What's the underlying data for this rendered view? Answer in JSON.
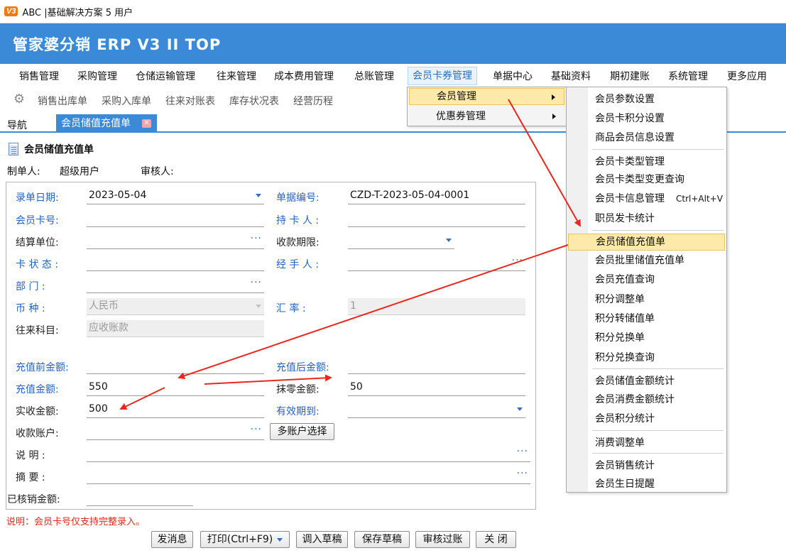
{
  "titlebar": {
    "logo": "V3",
    "title": "ABC  |基础解决方案 5 用户"
  },
  "banner": {
    "app_name": "管家婆分销 ERP V3 II TOP"
  },
  "menu": [
    {
      "label": "销售管理"
    },
    {
      "label": "采购管理"
    },
    {
      "label": "仓储运输管理"
    },
    {
      "label": "往来管理"
    },
    {
      "label": "成本费用管理"
    },
    {
      "label": "总账管理"
    },
    {
      "label": "会员卡券管理"
    },
    {
      "label": "单据中心"
    },
    {
      "label": "基础资料"
    },
    {
      "label": "期初建账"
    },
    {
      "label": "系统管理"
    },
    {
      "label": "更多应用"
    }
  ],
  "toolbar": [
    "销售出库单",
    "采购入库单",
    "往来对账表",
    "库存状况表",
    "经营历程"
  ],
  "tabs": {
    "nav": "导航",
    "active": "会员储值充值单",
    "close": "✕"
  },
  "form": {
    "title": "会员储值充值单",
    "maker_label": "制单人:",
    "maker_value": "超级用户",
    "auditor_label": "审核人:",
    "fields": {
      "entry_date": {
        "label": "录单日期:",
        "value": "2023-05-04"
      },
      "doc_no": {
        "label": "单据编号:",
        "value": "CZD-T-2023-05-04-0001"
      },
      "card_no": {
        "label": "会员卡号:",
        "value": ""
      },
      "holder": {
        "label": "持 卡 人 :",
        "value": ""
      },
      "settle_unit": {
        "label": "结算单位:",
        "value": ""
      },
      "pay_term": {
        "label": "收款期限:",
        "value": ""
      },
      "card_status": {
        "label": "卡 状 态 :",
        "value": ""
      },
      "handler": {
        "label": "经 手 人 :",
        "value": ""
      },
      "dept": {
        "label": "部     门   :",
        "value": ""
      },
      "currency": {
        "label": "币     种   :",
        "value": "人民币"
      },
      "rate": {
        "label": "汇     率   :",
        "value": "1"
      },
      "account_subject": {
        "label": "往来科目:",
        "value": "应收账款"
      },
      "before_amount": {
        "label": "充值前金额:",
        "value": ""
      },
      "after_amount": {
        "label": "充值后金额:",
        "value": ""
      },
      "charge_amount": {
        "label": "充值金额:",
        "value": "550"
      },
      "discount_amount": {
        "label": "抹零金额:",
        "value": "50"
      },
      "received_amount": {
        "label": "实收金额:",
        "value": "500"
      },
      "valid_until": {
        "label": "有效期到:",
        "value": ""
      },
      "receive_account": {
        "label": "收款账户:",
        "value": ""
      },
      "multi_account_btn": "多账户选择",
      "description": {
        "label": "说     明   :",
        "value": ""
      },
      "summary": {
        "label": "摘     要   :",
        "value": ""
      },
      "written_off": {
        "label": "已核销金额:",
        "value": ""
      }
    },
    "note": "说明：会员卡号仅支持完整录入。",
    "buttons": {
      "send": "发消息",
      "print": "打印(Ctrl+F9)",
      "load_draft": "调入草稿",
      "save_draft": "保存草稿",
      "audit": "审核过账",
      "close": "关 闭"
    },
    "ellipsis": "···"
  },
  "submenu1": [
    {
      "label": "会员管理"
    },
    {
      "label": "优惠券管理"
    }
  ],
  "submenu2": {
    "items": [
      {
        "label": "会员参数设置"
      },
      {
        "label": "会员卡积分设置"
      },
      {
        "label": "商品会员信息设置"
      },
      {
        "label": "会员卡类型管理"
      },
      {
        "label": "会员卡类型变更查询"
      },
      {
        "label": "会员卡信息管理",
        "shortcut": "Ctrl+Alt+V"
      },
      {
        "label": "职员发卡统计"
      },
      {
        "label": "会员储值充值单"
      },
      {
        "label": "会员批里储值充值单"
      },
      {
        "label": "会员充值查询"
      },
      {
        "label": "积分调整单"
      },
      {
        "label": "积分转储值单"
      },
      {
        "label": "积分兑换单"
      },
      {
        "label": "积分兑换查询"
      },
      {
        "label": "会员储值金额统计"
      },
      {
        "label": "会员消费金额统计"
      },
      {
        "label": "会员积分统计"
      },
      {
        "label": "消费调整单"
      },
      {
        "label": "会员销售统计"
      },
      {
        "label": "会员生日提醒"
      }
    ]
  },
  "colors": {
    "accent": "#3b8ad8",
    "highlight": "#fde9a9",
    "label_blue": "#2860c0",
    "annotation_red": "#e8281e"
  }
}
